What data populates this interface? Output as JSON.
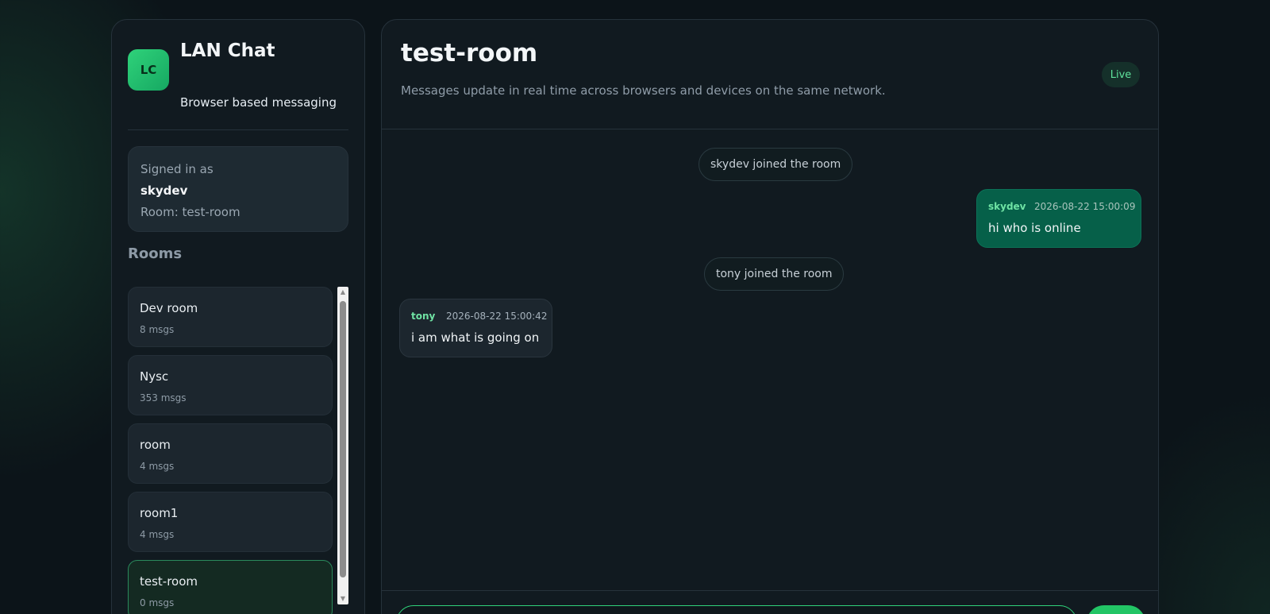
{
  "brand": {
    "logo_text": "LC",
    "title": "LAN Chat",
    "subtitle": "Browser based messaging"
  },
  "session": {
    "signed_in_label": "Signed in as",
    "username": "skydev",
    "room_line": "Room: test-room"
  },
  "rooms": {
    "heading": "Rooms",
    "items": [
      {
        "name": "Dev room",
        "count": "8 msgs",
        "active": false
      },
      {
        "name": "Nysc",
        "count": "353 msgs",
        "active": false
      },
      {
        "name": "room",
        "count": "4 msgs",
        "active": false
      },
      {
        "name": "room1",
        "count": "4 msgs",
        "active": false
      },
      {
        "name": "test-room",
        "count": "0 msgs",
        "active": true
      }
    ]
  },
  "chat": {
    "title": "test-room",
    "subtitle": "Messages update in real time across browsers and devices on the same network.",
    "status_badge": "Live",
    "messages": [
      {
        "type": "system",
        "text": "skydev joined the room"
      },
      {
        "type": "mine",
        "author": "skydev",
        "time": "2026-08-22 15:00:09",
        "text": "hi who is online"
      },
      {
        "type": "system",
        "text": "tony joined the room"
      },
      {
        "type": "theirs",
        "author": "tony",
        "time": "2026-08-22 15:00:42",
        "text": "i am what is going on"
      }
    ]
  },
  "composer": {
    "value": "",
    "placeholder": "",
    "send_label": ""
  },
  "colors": {
    "accent": "#22c565",
    "my_bubble": "#066049",
    "background": "#0c1419"
  }
}
